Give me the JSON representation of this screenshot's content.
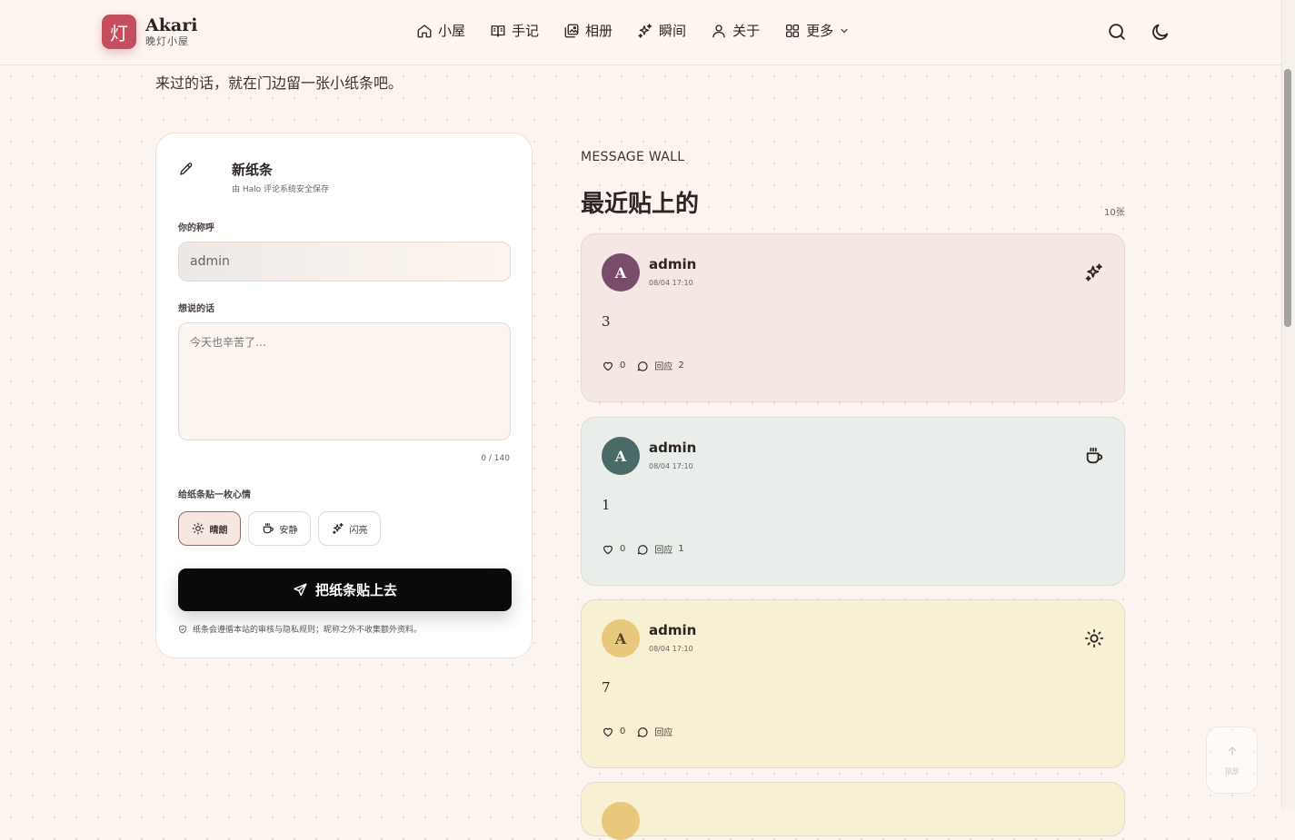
{
  "brand": {
    "logo_glyph": "灯",
    "name": "Akari",
    "subtitle": "晚灯小屋"
  },
  "nav": [
    {
      "label": "小屋",
      "icon": "home-icon"
    },
    {
      "label": "手记",
      "icon": "book-icon"
    },
    {
      "label": "相册",
      "icon": "gallery-icon"
    },
    {
      "label": "瞬间",
      "icon": "sparkle-icon"
    },
    {
      "label": "关于",
      "icon": "user-icon"
    },
    {
      "label": "更多",
      "icon": "grid-icon"
    }
  ],
  "intro": "来过的话，就在门边留一张小纸条吧。",
  "form": {
    "title": "新纸条",
    "subtitle": "由 Halo 评论系统安全保存",
    "name_label": "你的称呼",
    "name_value": "admin",
    "message_label": "想说的话",
    "message_placeholder": "今天也辛苦了…",
    "counter": "0 / 140",
    "mood_label": "给纸条贴一枚心情",
    "moods": [
      {
        "label": "晴朗",
        "icon": "sun-icon",
        "selected": true
      },
      {
        "label": "安静",
        "icon": "cup-icon",
        "selected": false
      },
      {
        "label": "闪亮",
        "icon": "sparkle-icon",
        "selected": false
      }
    ],
    "submit_label": "把纸条贴上去",
    "policy": "纸条会遵循本站的审核与隐私规则；昵称之外不收集额外资料。"
  },
  "wall": {
    "eyebrow": "MESSAGE WALL",
    "title": "最近贴上的",
    "count": "10张",
    "notes": [
      {
        "initial": "A",
        "author": "admin",
        "time": "08/04 17:10",
        "body": "3",
        "likes": "0",
        "reply_label": "回应",
        "reply_count": "2",
        "mood_icon": "sparkle-icon",
        "bg": "#f5e7e3",
        "avatar_bg": "#7a4c6b",
        "avatar_fg": "#ffffff"
      },
      {
        "initial": "A",
        "author": "admin",
        "time": "08/04 17:10",
        "body": "1",
        "likes": "0",
        "reply_label": "回应",
        "reply_count": "1",
        "mood_icon": "cup-icon",
        "bg": "#e9eeeb",
        "avatar_bg": "#4a6a67",
        "avatar_fg": "#ffffff"
      },
      {
        "initial": "A",
        "author": "admin",
        "time": "08/04 17:10",
        "body": "7",
        "likes": "0",
        "reply_label": "回应",
        "reply_count": "",
        "mood_icon": "sun-icon",
        "bg": "#f8f0d3",
        "avatar_bg": "#e8c87c",
        "avatar_fg": "#5a4520"
      }
    ]
  },
  "back_to_top_label": "顶部"
}
